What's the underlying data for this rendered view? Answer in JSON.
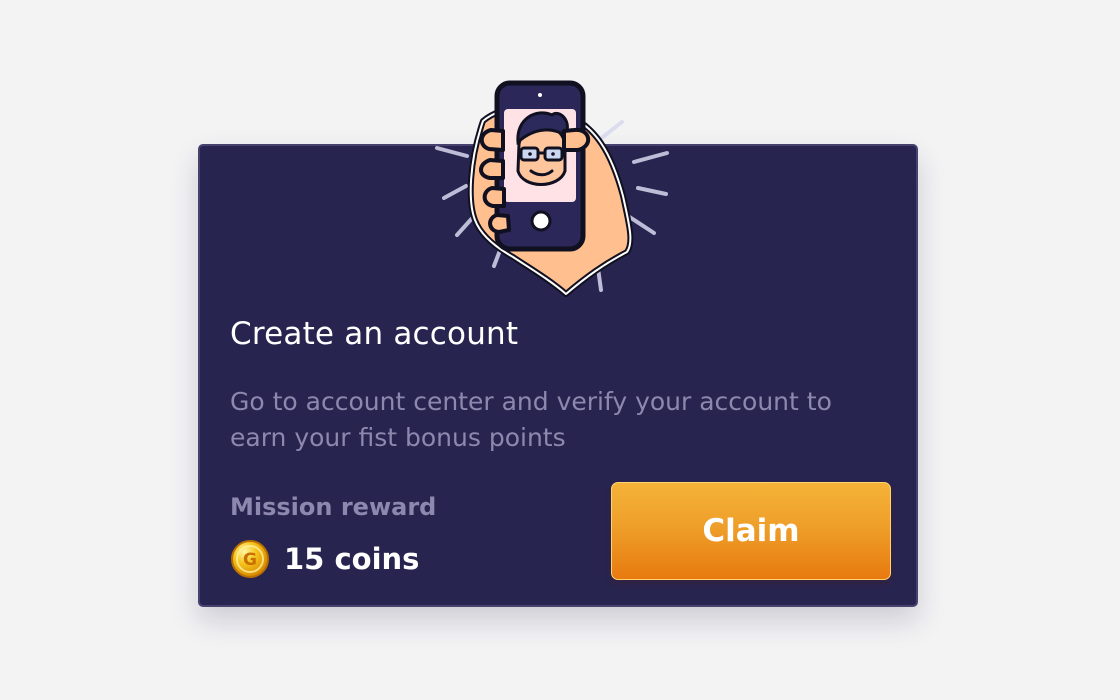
{
  "mission": {
    "title": "Create an account",
    "description": "Go to account center and verify your account to earn your fist bonus points",
    "reward_label": "Mission reward",
    "reward_value": "15 coins",
    "claim_label": "Claim",
    "coin_symbol": "G"
  },
  "icons": {
    "illustration": "hand-holding-phone-selfie-icon",
    "reward": "gold-coin-icon"
  },
  "colors": {
    "page_background": "#f3f3f4",
    "card_background": "#282450",
    "card_border": "#46416e",
    "title": "#ffffff",
    "muted_text": "#8d88ad",
    "claim_top": "#f5b338",
    "claim_bottom": "#e87a10",
    "coin": "#f6c51c"
  }
}
